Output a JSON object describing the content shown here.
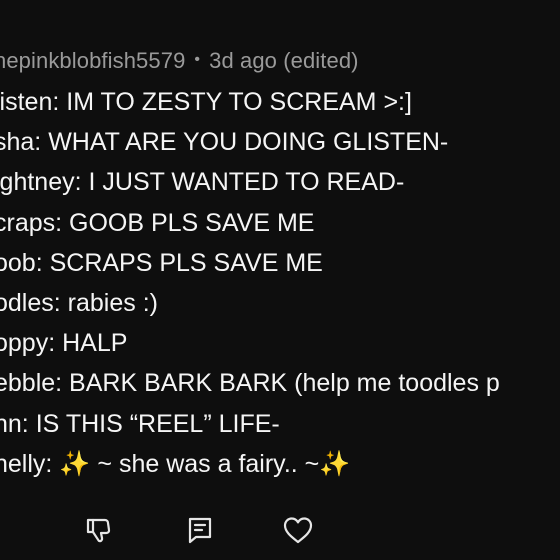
{
  "comment": {
    "username": "hepinkblobfish5579",
    "separator": "•",
    "timestamp": "3d ago (edited)",
    "lines": [
      {
        "text": "listen: IM TO ZESTY TO SCREAM >:]"
      },
      {
        "text": "sha: WHAT ARE YOU DOING GLISTEN-"
      },
      {
        "text": "ightney: I JUST WANTED TO READ-"
      },
      {
        "text": "craps: GOOB PLS SAVE ME"
      },
      {
        "text": "oob: SCRAPS PLS SAVE ME"
      },
      {
        "text": "odles: rabies :)"
      },
      {
        "text": "oppy: HALP"
      },
      {
        "text": "ebble: BARK BARK BARK (help me toodles p"
      },
      {
        "text": "nn: IS THIS “REEL” LIFE-"
      },
      {
        "prefix": "nelly: ",
        "sparkle_left": "✨",
        "middle": " ~ she was a fairy.. ~",
        "sparkle_right": "✨"
      }
    ]
  },
  "actions": {
    "icons": [
      "upvote-icon",
      "dislike-icon",
      "reply-icon",
      "heart-icon"
    ]
  },
  "colors": {
    "background": "#0e0e0e",
    "text": "#f5f5f5",
    "meta": "#9a9a9a",
    "icon": "#e6e6e6",
    "sparkle": "#ffcf33"
  }
}
